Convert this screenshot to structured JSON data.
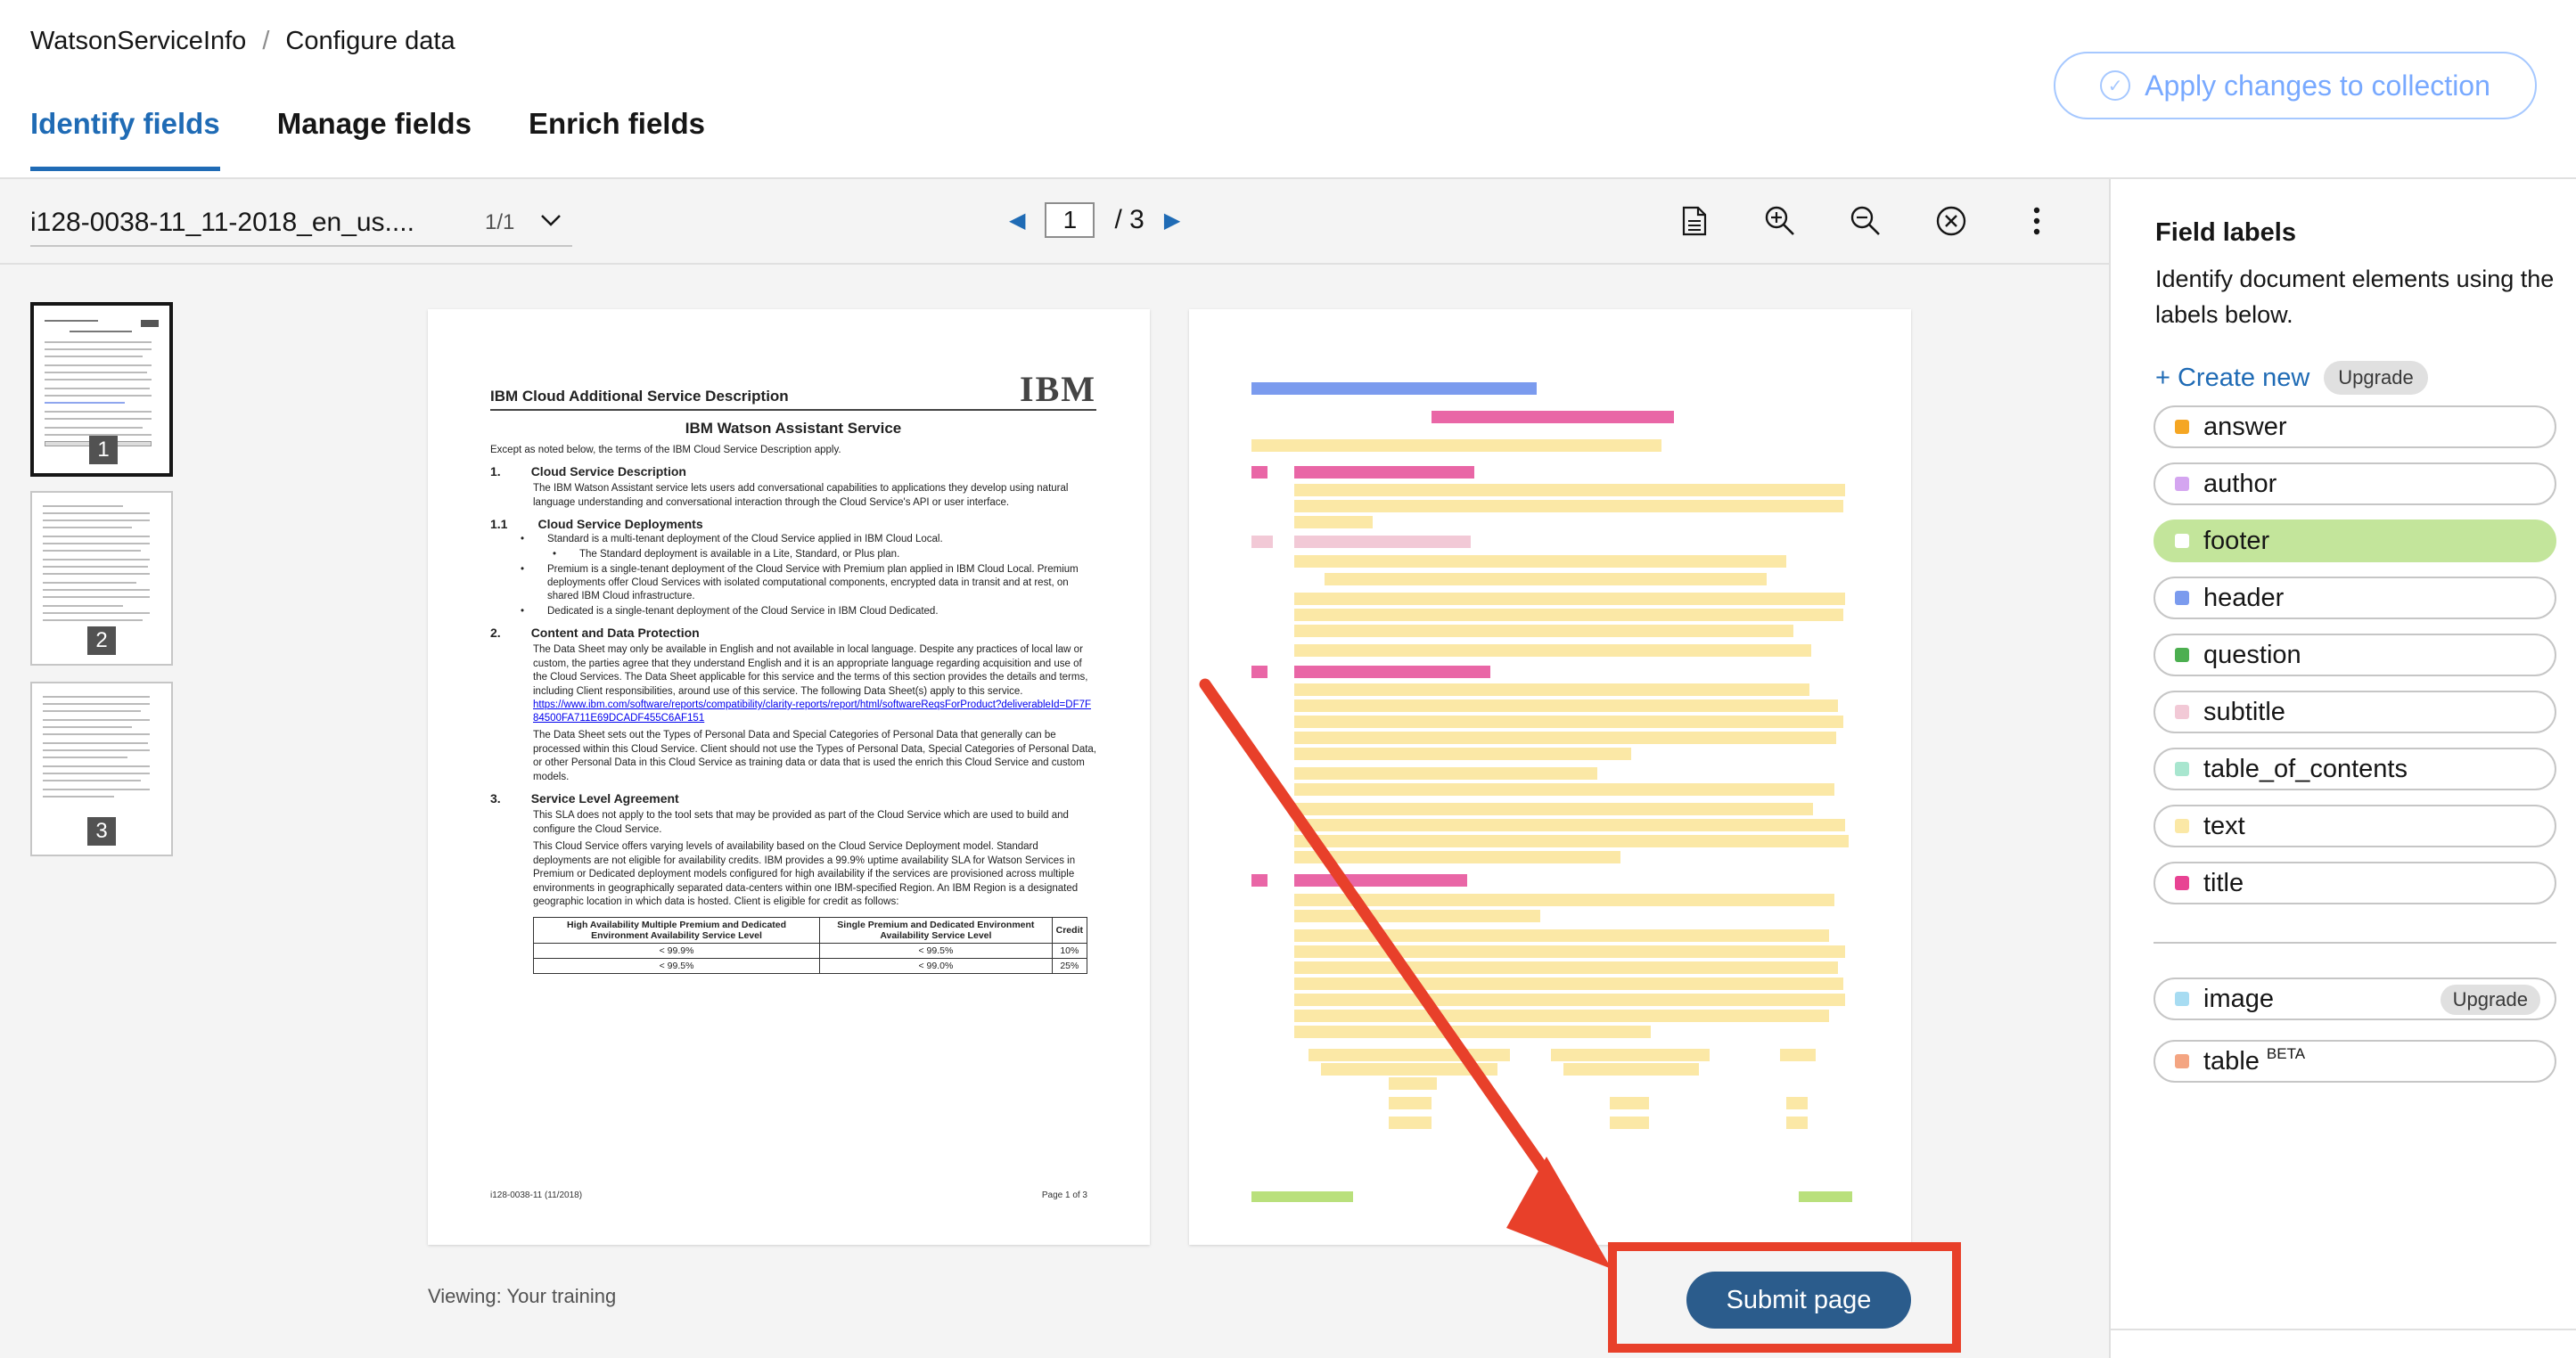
{
  "breadcrumb": {
    "app": "WatsonServiceInfo",
    "separator": "/",
    "current": "Configure data"
  },
  "tabs": [
    {
      "label": "Identify fields",
      "active": true
    },
    {
      "label": "Manage fields",
      "active": false
    },
    {
      "label": "Enrich fields",
      "active": false
    }
  ],
  "apply_button": {
    "label": "Apply changes to collection"
  },
  "toolbar": {
    "doc_name": "i128-0038-11_11-2018_en_us....",
    "doc_count": "1/1",
    "current_page": "1",
    "total_pages": "/ 3"
  },
  "thumbnails": [
    {
      "num": "1"
    },
    {
      "num": "2"
    },
    {
      "num": "3"
    }
  ],
  "document": {
    "logo": "IBM",
    "title": "IBM Cloud Additional Service Description",
    "subtitle": "IBM Watson Assistant Service",
    "intro": "Except as noted below, the terms of the IBM Cloud Service Description apply.",
    "s1_num": "1.",
    "s1_title": "Cloud Service Description",
    "s1_body": "The IBM Watson Assistant service lets users add conversational capabilities to applications they develop using natural language understanding and conversational interaction through the Cloud Service's API or user interface.",
    "s11_num": "1.1",
    "s11_title": "Cloud Service Deployments",
    "b1": "Standard is a multi-tenant deployment of the Cloud Service applied in IBM Cloud Local.",
    "b1a": "The Standard deployment is available in a Lite, Standard, or Plus plan.",
    "b2": "Premium is a single-tenant deployment of the Cloud Service with Premium plan applied in IBM Cloud Local. Premium deployments offer Cloud Services with isolated computational components, encrypted data in transit and at rest, on shared IBM Cloud infrastructure.",
    "b3": "Dedicated is a single-tenant deployment of the Cloud Service in IBM Cloud Dedicated.",
    "s2_num": "2.",
    "s2_title": "Content and Data Protection",
    "s2_body": "The Data Sheet may only be available in English and not available in local language. Despite any practices of local law or custom, the parties agree that they understand English and it is an appropriate language regarding acquisition and use of the Cloud Services. The Data Sheet applicable for this service and the terms of this section provides the details and terms, including Client responsibilities, around use of this service. The following Data Sheet(s) apply to this service.",
    "s2_link": "https://www.ibm.com/software/reports/compatibility/clarity-reports/report/html/softwareReqsForProduct?deliverableId=DF7F84500FA711E69DCADF455C6AF151",
    "s2_body2": "The Data Sheet sets out the Types of Personal Data and Special Categories of Personal Data that generally can be processed within this Cloud Service. Client should not use the Types of Personal Data, Special Categories of Personal Data, or other Personal Data in this Cloud Service as training data or data that is used the enrich this Cloud Service and custom models.",
    "s3_num": "3.",
    "s3_title": "Service Level Agreement",
    "s3_body": "This SLA does not apply to the tool sets that may be provided as part of the Cloud Service which are used to build and configure the Cloud Service.",
    "s3_body2": "This Cloud Service offers varying levels of availability based on the Cloud Service Deployment model. Standard deployments are not eligible for availability credits. IBM provides a 99.9% uptime availability SLA for Watson Services in Premium or Dedicated deployment models configured for high availability if the services are provisioned across multiple environments in geographically separated data-centers within one IBM-specified Region. An IBM Region is a designated geographic location in which data is hosted. Client is eligible for credit as follows:",
    "table": {
      "headers": [
        "High Availability Multiple Premium and Dedicated Environment Availability Service Level",
        "Single Premium and Dedicated Environment Availability Service Level",
        "Credit"
      ],
      "rows": [
        [
          "< 99.9%",
          "< 99.5%",
          "10%"
        ],
        [
          "< 99.5%",
          "< 99.0%",
          "25%"
        ]
      ]
    },
    "footer_left": "i128-0038-11 (11/2018)",
    "footer_right": "Page 1 of 3"
  },
  "viewing_label": "Viewing: Your training",
  "submit_button": {
    "label": "Submit page"
  },
  "panel": {
    "title": "Field labels",
    "description": "Identify document elements using the labels below.",
    "create_new": "+ Create new",
    "upgrade": "Upgrade",
    "labels": [
      {
        "name": "answer",
        "color": "#f5a623",
        "active": false
      },
      {
        "name": "author",
        "color": "#d4a5f0",
        "active": false
      },
      {
        "name": "footer",
        "color": "#ffffff",
        "active": true
      },
      {
        "name": "header",
        "color": "#7b9bee",
        "active": false
      },
      {
        "name": "question",
        "color": "#4caf50",
        "active": false
      },
      {
        "name": "subtitle",
        "color": "#f2c9d6",
        "active": false
      },
      {
        "name": "table_of_contents",
        "color": "#a8e6cf",
        "active": false
      },
      {
        "name": "text",
        "color": "#fbe8a6",
        "active": false
      },
      {
        "name": "title",
        "color": "#e84393",
        "active": false
      }
    ],
    "extra_labels": [
      {
        "name": "image",
        "color": "#a7dcf2",
        "tag": "Upgrade"
      },
      {
        "name": "table",
        "color": "#f4a582",
        "sup": "BETA"
      }
    ]
  },
  "colors": {
    "accent": "#1f6bb5",
    "submit": "#2b5c8c",
    "annotation_red": "#e8402a",
    "footer_active": "#c3e59b"
  }
}
